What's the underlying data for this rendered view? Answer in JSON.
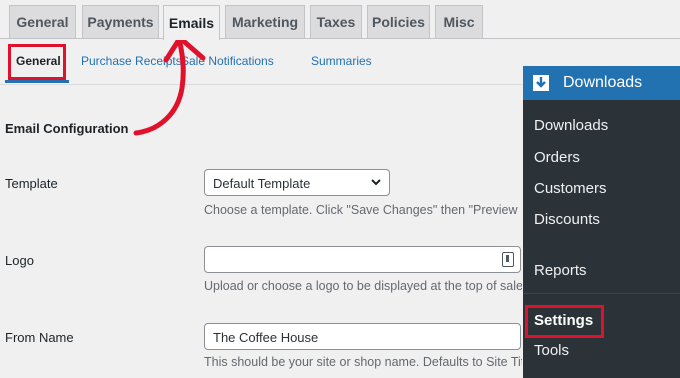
{
  "tabs": [
    {
      "label": "General",
      "active": false
    },
    {
      "label": "Payments",
      "active": false
    },
    {
      "label": "Emails",
      "active": true
    },
    {
      "label": "Marketing",
      "active": false
    },
    {
      "label": "Taxes",
      "active": false
    },
    {
      "label": "Policies",
      "active": false
    },
    {
      "label": "Misc",
      "active": false
    }
  ],
  "subnav": [
    {
      "label": "General",
      "current": true
    },
    {
      "label": "Purchase Receipts",
      "current": false
    },
    {
      "label": "Sale Notifications",
      "current": false
    },
    {
      "label": "Summaries",
      "current": false
    }
  ],
  "section_title": "Email Configuration",
  "fields": {
    "template": {
      "label": "Template",
      "value": "Default Template",
      "description": "Choose a template. Click \"Save Changes\" then \"Preview Purchase Receipt\" to see the new template."
    },
    "logo": {
      "label": "Logo",
      "value": "",
      "description": "Upload or choose a logo to be displayed at the top of sales receipt emails."
    },
    "from_name": {
      "label": "From Name",
      "value": "The Coffee House",
      "description": "This should be your site or shop name. Defaults to Site Title if empty."
    }
  },
  "sidebar": {
    "header": "Downloads",
    "items": [
      "Downloads",
      "Orders",
      "Customers",
      "Discounts",
      "Reports",
      "Settings",
      "Tools"
    ],
    "active_item": "Settings"
  },
  "colors": {
    "accent": "#2271b1",
    "highlight": "#e0112a",
    "sidebar_bg": "#2c3338"
  },
  "icons": {
    "sidebar_header": "download-icon",
    "template_select": "chevron-down-icon",
    "logo_upload": "upload-icon",
    "annotation": "curved-arrow-icon"
  }
}
